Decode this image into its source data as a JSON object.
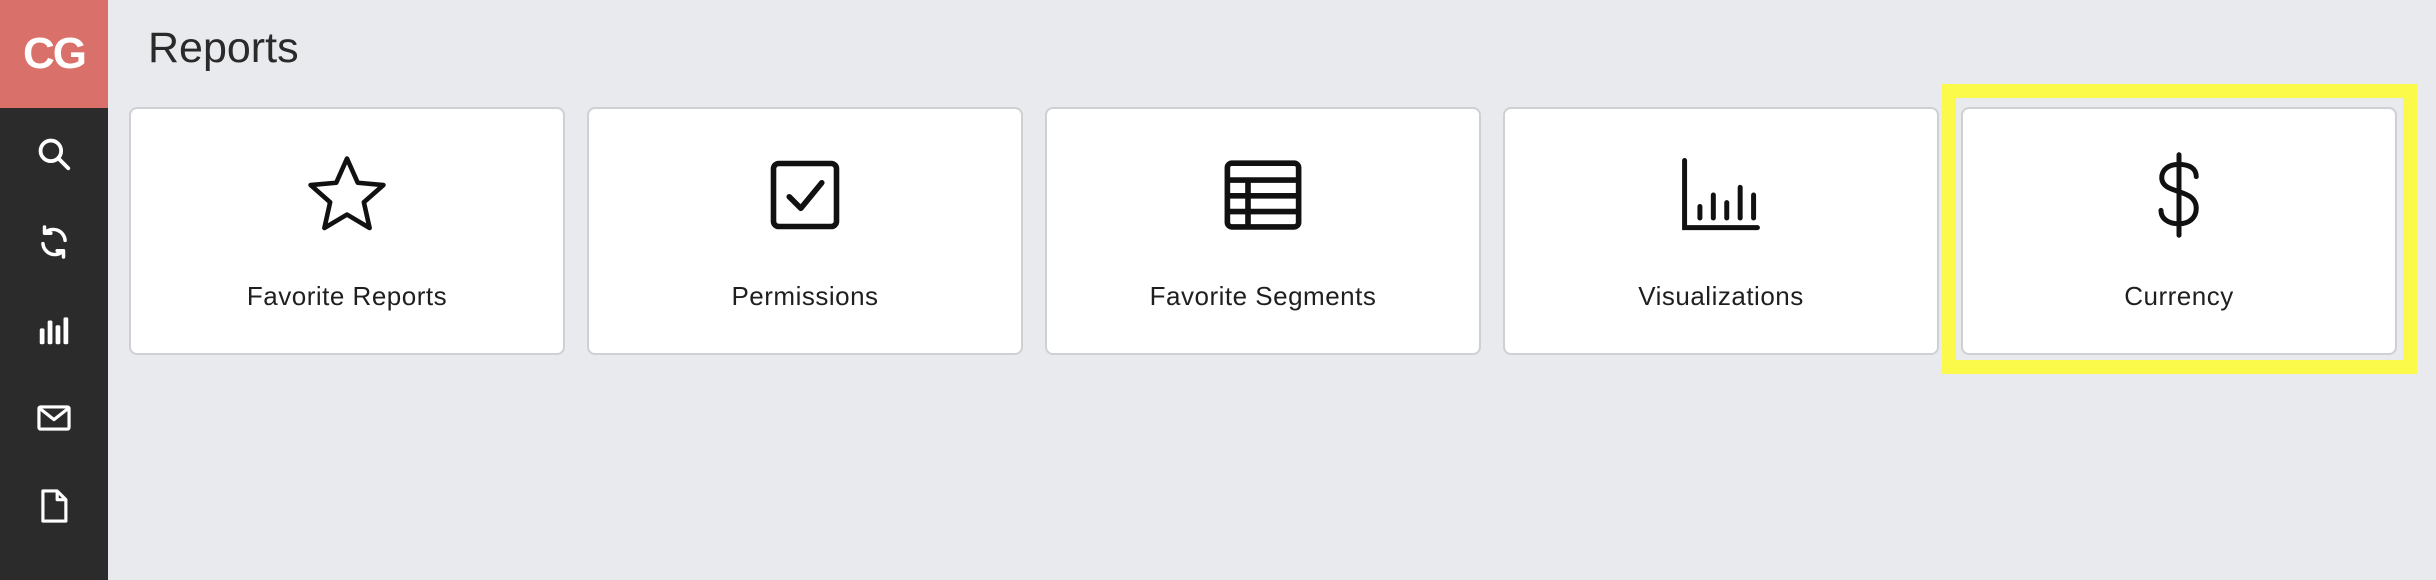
{
  "sidebar": {
    "logo_text": "CG",
    "logo_color": "#d9716a",
    "background": "#2b2b2b",
    "items": [
      {
        "icon": "search-icon"
      },
      {
        "icon": "refresh-icon"
      },
      {
        "icon": "bar-chart-icon"
      },
      {
        "icon": "mail-icon"
      },
      {
        "icon": "document-icon"
      }
    ]
  },
  "page": {
    "title": "Reports"
  },
  "tiles": [
    {
      "label": "Favorite Reports",
      "icon": "star-icon"
    },
    {
      "label": "Permissions",
      "icon": "checkbox-icon"
    },
    {
      "label": "Favorite Segments",
      "icon": "table-icon"
    },
    {
      "label": "Visualizations",
      "icon": "bar-chart-icon"
    },
    {
      "label": "Currency",
      "icon": "dollar-icon",
      "highlighted": true
    }
  ],
  "colors": {
    "highlight": "#fbf94a",
    "background": "#e9eaee"
  }
}
